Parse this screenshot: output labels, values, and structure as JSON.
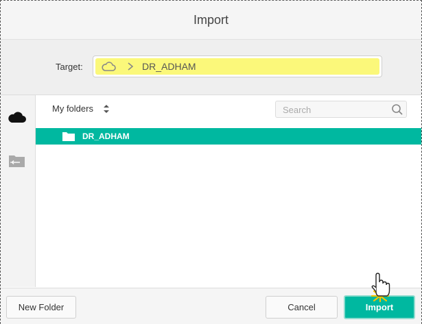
{
  "dialog": {
    "title": "Import"
  },
  "target": {
    "label": "Target:",
    "path_icon": "cloud-icon",
    "separator_icon": "chevron-right-icon",
    "folder": "DR_ADHAM",
    "highlight_color": "#fbf87a"
  },
  "sidebar": {
    "items": [
      {
        "icon": "cloud-icon"
      },
      {
        "icon": "server-folder-icon"
      }
    ]
  },
  "browser": {
    "header_label": "My folders",
    "sort_icon": "sort-icon",
    "search_placeholder": "Search",
    "search_icon": "search-icon",
    "folders": [
      {
        "name": "DR_ADHAM",
        "icon": "folder-icon",
        "selected": true
      }
    ],
    "selected_color": "#00b8a0"
  },
  "footer": {
    "new_folder_label": "New Folder",
    "cancel_label": "Cancel",
    "import_label": "Import"
  }
}
